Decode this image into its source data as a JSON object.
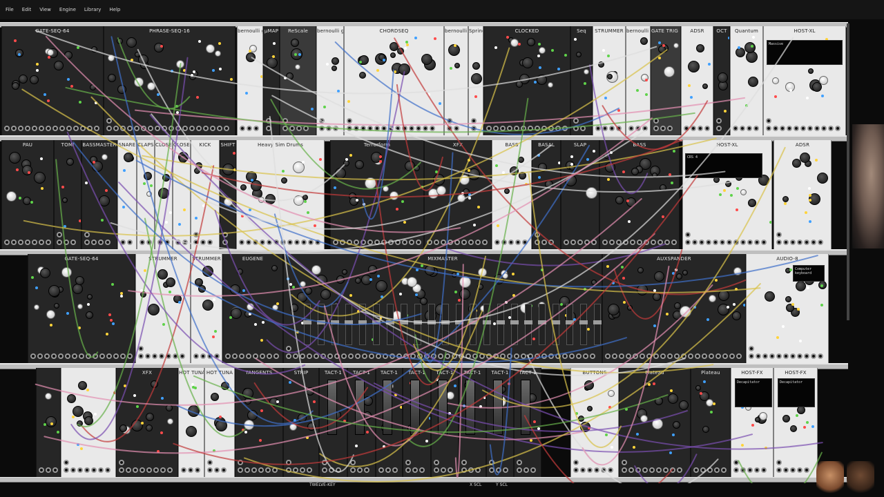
{
  "menu": [
    {
      "label": "File"
    },
    {
      "label": "Edit"
    },
    {
      "label": "View"
    },
    {
      "label": "Engine"
    },
    {
      "label": "Library"
    },
    {
      "label": "Help"
    }
  ],
  "rows": [
    {
      "modules": [
        {
          "title": "GATE-SEQ-64",
          "theme": "dark"
        },
        {
          "title": "PHRASE-SEQ-16",
          "theme": "dark"
        },
        {
          "title": "bernoulli gate",
          "theme": "light"
        },
        {
          "title": "µMAP",
          "theme": "dark"
        },
        {
          "title": "ReScale",
          "theme": "mid"
        },
        {
          "title": "bernoulli gate",
          "theme": "light"
        },
        {
          "title": "CHORDSEQ",
          "theme": "light"
        },
        {
          "title": "bernoulli gate",
          "theme": "light"
        },
        {
          "title": "Springs",
          "theme": "light"
        },
        {
          "title": "CLOCKED",
          "theme": "dark"
        },
        {
          "title": "Seq",
          "theme": "dark"
        },
        {
          "title": "STRUMMER",
          "theme": "light"
        },
        {
          "title": "bernoulli gate",
          "theme": "light"
        },
        {
          "title": "GATE TRIG MERGER",
          "theme": "mid"
        },
        {
          "title": "ADSR",
          "theme": "light"
        },
        {
          "title": "OCT",
          "theme": "dark"
        },
        {
          "title": "Quantum",
          "theme": "light"
        },
        {
          "title": "HOST-XL",
          "theme": "light"
        }
      ]
    },
    {
      "modules": [
        {
          "title": "PAU",
          "theme": "dark"
        },
        {
          "title": "TOMI",
          "theme": "dark"
        },
        {
          "title": "BASSMASTER",
          "theme": "dark"
        },
        {
          "title": "SNARE",
          "theme": "light"
        },
        {
          "title": "CLAPS",
          "theme": "light"
        },
        {
          "title": "CLOSED HI HATS",
          "theme": "light"
        },
        {
          "title": "CLOSED HI HATS",
          "theme": "light"
        },
        {
          "title": "KICK",
          "theme": "light"
        },
        {
          "title": "SHIFT",
          "theme": "dark"
        },
        {
          "title": "Heavy Sim Drums",
          "theme": "light"
        },
        {
          "title": "Terrorform",
          "theme": "dark"
        },
        {
          "title": "XFX",
          "theme": "dark"
        },
        {
          "title": "BASS",
          "theme": "light"
        },
        {
          "title": "BASAL",
          "theme": "dark"
        },
        {
          "title": "SLAP",
          "theme": "dark"
        },
        {
          "title": "BASS",
          "theme": "dark"
        },
        {
          "title": "HOST-XL",
          "theme": "light"
        },
        {
          "title": "ADSR",
          "theme": "light"
        }
      ]
    },
    {
      "modules": [
        {
          "title": "GATE-SEQ-64",
          "theme": "dark"
        },
        {
          "title": "STRUMMER",
          "theme": "light"
        },
        {
          "title": "STRUMMER",
          "theme": "light"
        },
        {
          "title": "EUGENE",
          "theme": "dark"
        },
        {
          "title": "MIXMASTER",
          "theme": "dark"
        },
        {
          "title": "AUXSPANDER",
          "theme": "dark"
        },
        {
          "title": "AUDIO-8",
          "theme": "light"
        }
      ]
    },
    {
      "modules": [
        {
          "title": "",
          "theme": "dark"
        },
        {
          "title": "",
          "theme": "light"
        },
        {
          "title": "XFX",
          "theme": "dark"
        },
        {
          "title": "HOT TUNA",
          "theme": "light"
        },
        {
          "title": "HOT TUNA",
          "theme": "light"
        },
        {
          "title": "TANGENTS",
          "theme": "dark"
        },
        {
          "title": "STRIP",
          "theme": "dark"
        },
        {
          "title": "TACT-1",
          "theme": "dark"
        },
        {
          "title": "TACT-1",
          "theme": "dark"
        },
        {
          "title": "TACT-1",
          "theme": "dark"
        },
        {
          "title": "TACT-1",
          "theme": "dark"
        },
        {
          "title": "TACT-1",
          "theme": "dark"
        },
        {
          "title": "TACT-1",
          "theme": "dark"
        },
        {
          "title": "TACT-1",
          "theme": "dark"
        },
        {
          "title": "TACT-1",
          "theme": "dark"
        },
        {
          "title": "BUTTONS",
          "theme": "light"
        },
        {
          "title": "Plateau",
          "theme": "dark"
        },
        {
          "title": "Plateau",
          "theme": "dark"
        },
        {
          "title": "HOST-FX",
          "theme": "light"
        },
        {
          "title": "HOST-FX",
          "theme": "light"
        }
      ]
    }
  ],
  "screens": {
    "host_xl_top": "Massive",
    "host_xl_mid": "CRS 4",
    "audio8": "Computer keyboard",
    "host_fx_1": "Decapitator",
    "host_fx_2": "Decapitator"
  },
  "status": {
    "item1": "TWELVE-KEY",
    "item2": "X SCL",
    "item3": "Y SCL"
  },
  "colors": {
    "background": "#0b0b0b",
    "rail": "#bfbfbf",
    "module_light": "#e9e9e9",
    "module_dark": "#262626",
    "cable_yellow": "#d9c24a",
    "cable_green": "#66b04a",
    "cable_red": "#c23a3a",
    "cable_purple": "#7a4fb0",
    "cable_blue": "#3f6fc9",
    "cable_pink": "#e28fb0",
    "cable_white": "#dddddd"
  }
}
